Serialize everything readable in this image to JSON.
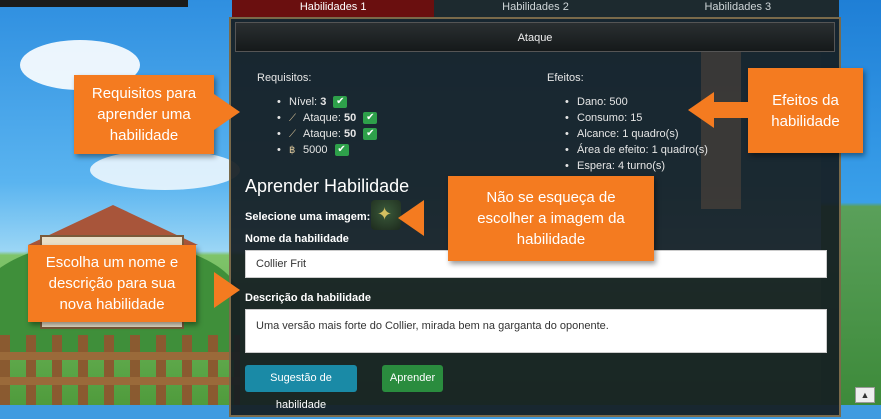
{
  "tabs": [
    {
      "label": "Habilidades 1",
      "active": true
    },
    {
      "label": "Habilidades 2",
      "active": false
    },
    {
      "label": "Habilidades 3",
      "active": false
    }
  ],
  "panel": {
    "header": "Ataque",
    "requirements": {
      "title": "Requisitos:",
      "items": [
        {
          "icon": "level-icon",
          "label": "Nível:",
          "value": "3"
        },
        {
          "icon": "blade-icon",
          "label": "Ataque:",
          "value": "50"
        },
        {
          "icon": "blade-icon",
          "label": "Ataque:",
          "value": "50"
        },
        {
          "icon": "berry-icon",
          "label": "",
          "value": "5000"
        }
      ]
    },
    "effects": {
      "title": "Efeitos:",
      "items": [
        "Dano: 500",
        "Consumo: 15",
        "Alcance: 1 quadro(s)",
        "Área de efeito: 1 quadro(s)",
        "Espera: 4 turno(s)"
      ]
    },
    "learn": {
      "title": "Aprender Habilidade",
      "select_image_label": "Selecione uma imagem:",
      "name_label": "Nome da habilidade",
      "name_value": "Collier Frit",
      "description_label": "Descrição da habilidade",
      "description_value": "Uma versão mais forte do Collier, mirada bem na garganta do oponente.",
      "suggest_button": "Sugestão de habilidade",
      "learn_button": "Aprender"
    }
  },
  "callouts": {
    "requirements": "Requisitos para aprender uma habilidade",
    "effects": "Efeitos da habilidade",
    "image": "Não se esqueça de escolher a imagem da habilidade",
    "name": "Escolha um nome e descrição para sua nova habilidade"
  },
  "colors": {
    "callout": "#f47b20",
    "check": "#2ea04a",
    "active_tab": "#6a0f0f",
    "suggest_button": "#1a8aa6",
    "learn_button": "#2a8c3e"
  }
}
